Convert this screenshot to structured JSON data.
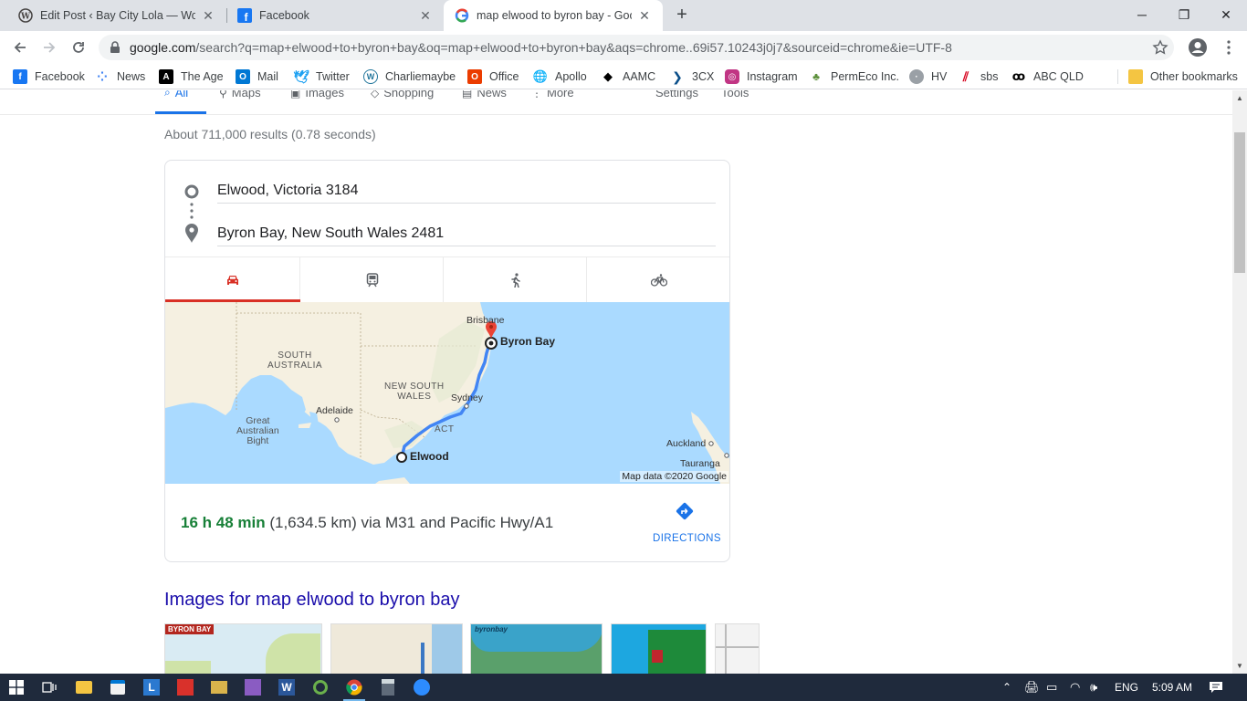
{
  "tabs": [
    {
      "title": "Edit Post ‹ Bay City Lola — WordPress",
      "icon": "wordpress-icon"
    },
    {
      "title": "Facebook",
      "icon": "facebook-icon"
    },
    {
      "title": "map elwood to byron bay - Google Search",
      "icon": "google-icon"
    }
  ],
  "window_controls": {
    "minimize": "─",
    "restore": "❐",
    "close": "✕"
  },
  "toolbar": {
    "url_host": "google.com",
    "url_rest": "/search?q=map+elwood+to+byron+bay&oq=map+elwood+to+byron+bay&aqs=chrome..69i57.10243j0j7&sourceid=chrome&ie=UTF-8"
  },
  "bookmarks": [
    {
      "label": "Facebook",
      "icon": "facebook-icon",
      "color": "#1877f2"
    },
    {
      "label": "News",
      "icon": "google-news-icon",
      "color": "#ffffff"
    },
    {
      "label": "The Age",
      "icon": "the-age-icon",
      "color": "#000000"
    },
    {
      "label": "Mail",
      "icon": "outlook-icon",
      "color": "#0078d4"
    },
    {
      "label": "Twitter",
      "icon": "twitter-icon",
      "color": "#1da1f2"
    },
    {
      "label": "Charliemaybe",
      "icon": "wordpress-icon",
      "color": "#ffffff"
    },
    {
      "label": "Office",
      "icon": "office-icon",
      "color": "#eb3c00"
    },
    {
      "label": "Apollo",
      "icon": "globe-icon",
      "color": "#ffffff"
    },
    {
      "label": "AAMC",
      "icon": "aamc-icon",
      "color": "#000000"
    },
    {
      "label": "3CX",
      "icon": "3cx-icon",
      "color": "#0b4f8a"
    },
    {
      "label": "Instagram",
      "icon": "instagram-icon",
      "color": "#c13584"
    },
    {
      "label": "PermEco Inc.",
      "icon": "permeco-icon",
      "color": "#5b8f3a"
    },
    {
      "label": "HV",
      "icon": "hv-icon",
      "color": "#9aa0a6"
    },
    {
      "label": "sbs",
      "icon": "sbs-icon",
      "color": "#d6001c"
    },
    {
      "label": "ABC QLD",
      "icon": "abc-icon",
      "color": "#000000"
    },
    {
      "label": "Other bookmarks",
      "icon": "folder-icon",
      "color": "#f4c542"
    }
  ],
  "search_nav": {
    "items": [
      "All",
      "Maps",
      "Images",
      "Shopping",
      "News",
      "More"
    ],
    "tools": [
      "Settings",
      "Tools"
    ],
    "active": "All"
  },
  "result_stats": "About 711,000 results (0.78 seconds)",
  "directions": {
    "origin": "Elwood, Victoria 3184",
    "destination": "Byron Bay, New South Wales 2481",
    "modes": [
      "driving",
      "transit",
      "walking",
      "cycling"
    ],
    "active_mode": "driving",
    "map": {
      "labels": {
        "brisbane": "Brisbane",
        "byron_bay": "Byron Bay",
        "south_australia": "SOUTH\nAUSTRALIA",
        "new_south_wales": "NEW SOUTH\nWALES",
        "sydney": "Sydney",
        "adelaide": "Adelaide",
        "great_australian_bight": "Great\nAustralian\nBight",
        "act": "ACT",
        "elwood": "Elwood",
        "auckland": "Auckland",
        "tauranga": "Tauranga"
      },
      "credit": "Map data ©2020 Google"
    },
    "duration": "16 h 48 min",
    "distance_route": "(1,634.5 km) via M31 and Pacific Hwy/A1",
    "directions_label": "DIRECTIONS"
  },
  "images_heading": "Images for map elwood to byron bay",
  "image_thumbs": [
    "BYRON BAY",
    "",
    "byronbay",
    "",
    ""
  ],
  "taskbar": {
    "lang": "ENG",
    "time": "5:09 AM"
  },
  "colors": {
    "accent_red": "#d93025",
    "duration_green": "#188038",
    "link_blue": "#1a73e8",
    "heading_blue": "#1a0dab",
    "water": "#aadaff",
    "land": "#f5f0e1",
    "route": "#4285f4"
  }
}
